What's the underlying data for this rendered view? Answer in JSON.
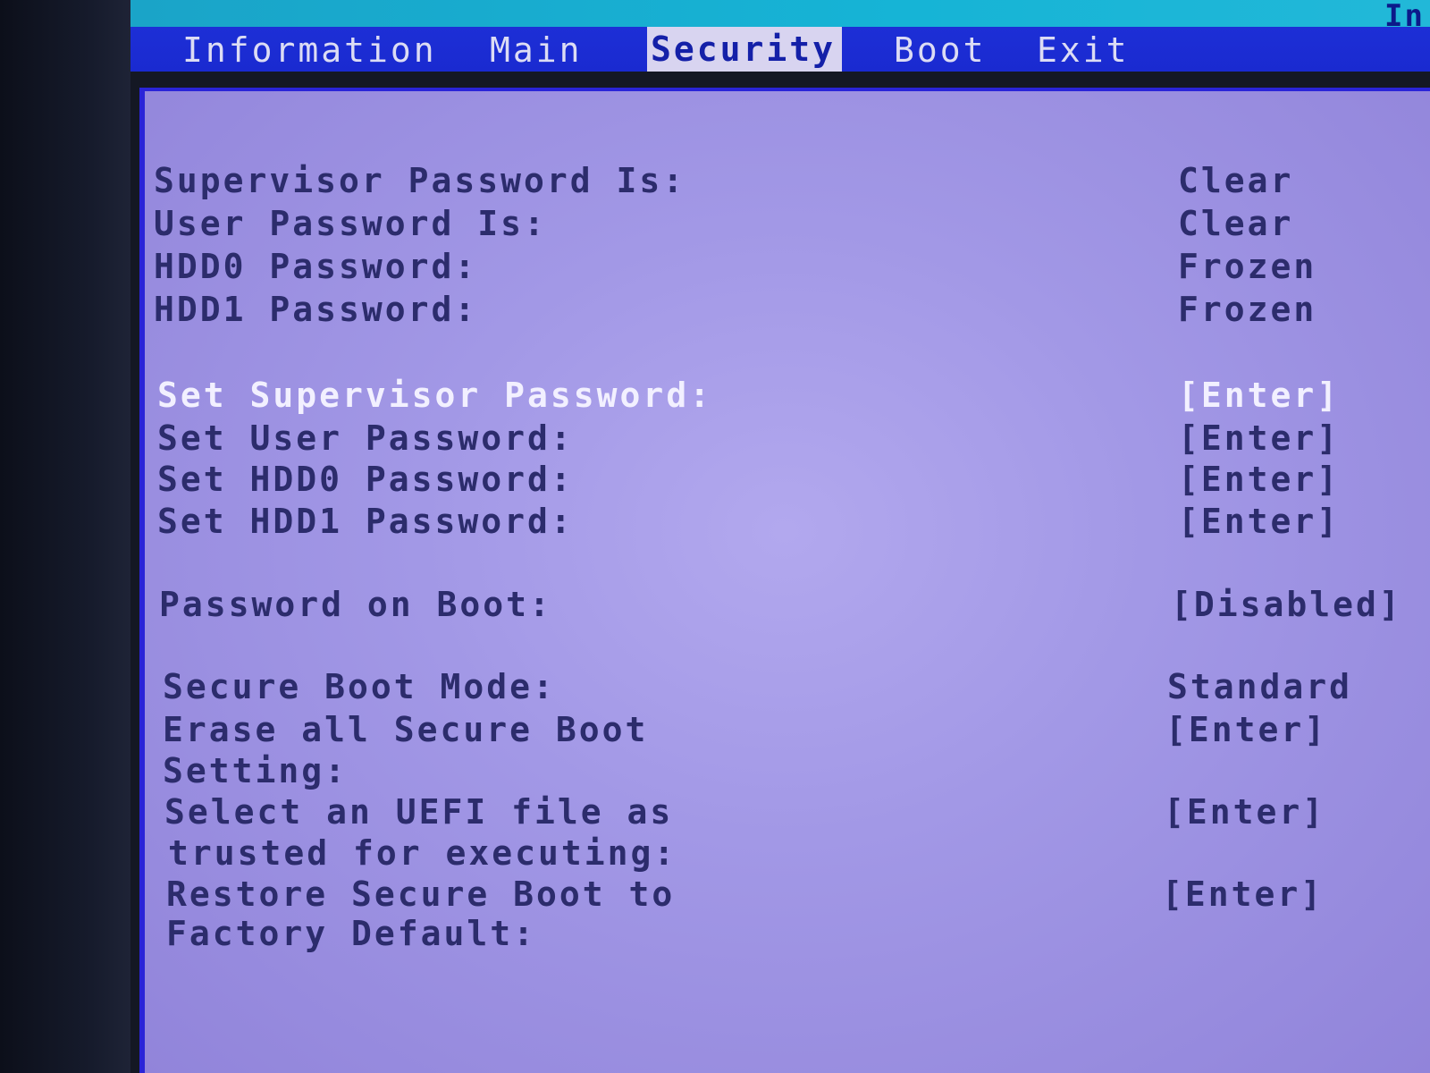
{
  "corner_text": "In",
  "tabs": [
    {
      "label": "Information",
      "active": false
    },
    {
      "label": "Main",
      "active": false
    },
    {
      "label": "Security",
      "active": true
    },
    {
      "label": "Boot",
      "active": false
    },
    {
      "label": "Exit",
      "active": false
    }
  ],
  "security": {
    "supervisor_password_is": {
      "label": "Supervisor Password Is:",
      "value": "Clear"
    },
    "user_password_is": {
      "label": "User Password Is:",
      "value": "Clear"
    },
    "hdd0_password": {
      "label": "HDD0 Password:",
      "value": "Frozen"
    },
    "hdd1_password": {
      "label": "HDD1 Password:",
      "value": "Frozen"
    },
    "set_supervisor_password": {
      "label": "Set Supervisor Password:",
      "value": "[Enter]"
    },
    "set_user_password": {
      "label": "Set User Password:",
      "value": "[Enter]"
    },
    "set_hdd0_password": {
      "label": "Set HDD0 Password:",
      "value": "[Enter]"
    },
    "set_hdd1_password": {
      "label": "Set HDD1 Password:",
      "value": "[Enter]"
    },
    "password_on_boot": {
      "label": "Password on Boot:",
      "value": "[Disabled]"
    },
    "secure_boot_mode": {
      "label": "Secure Boot Mode:",
      "value": "Standard"
    },
    "erase_secure_boot": {
      "label_line1": "Erase all Secure Boot",
      "label_line2": "Setting:",
      "value": "[Enter]"
    },
    "select_uefi_file": {
      "label_line1": "Select an UEFI file as",
      "label_line2": "trusted for executing:",
      "value": "[Enter]"
    },
    "restore_secure_boot": {
      "label_line1": "Restore Secure Boot to",
      "label_line2": "Factory Default:",
      "value": "[Enter]"
    }
  },
  "colors": {
    "panel": "#a298e6",
    "menubar": "#1a2ad0",
    "text": "#2c2c6c",
    "highlight_text": "#f2f0ff",
    "active_tab_bg": "#d8d4f0"
  }
}
